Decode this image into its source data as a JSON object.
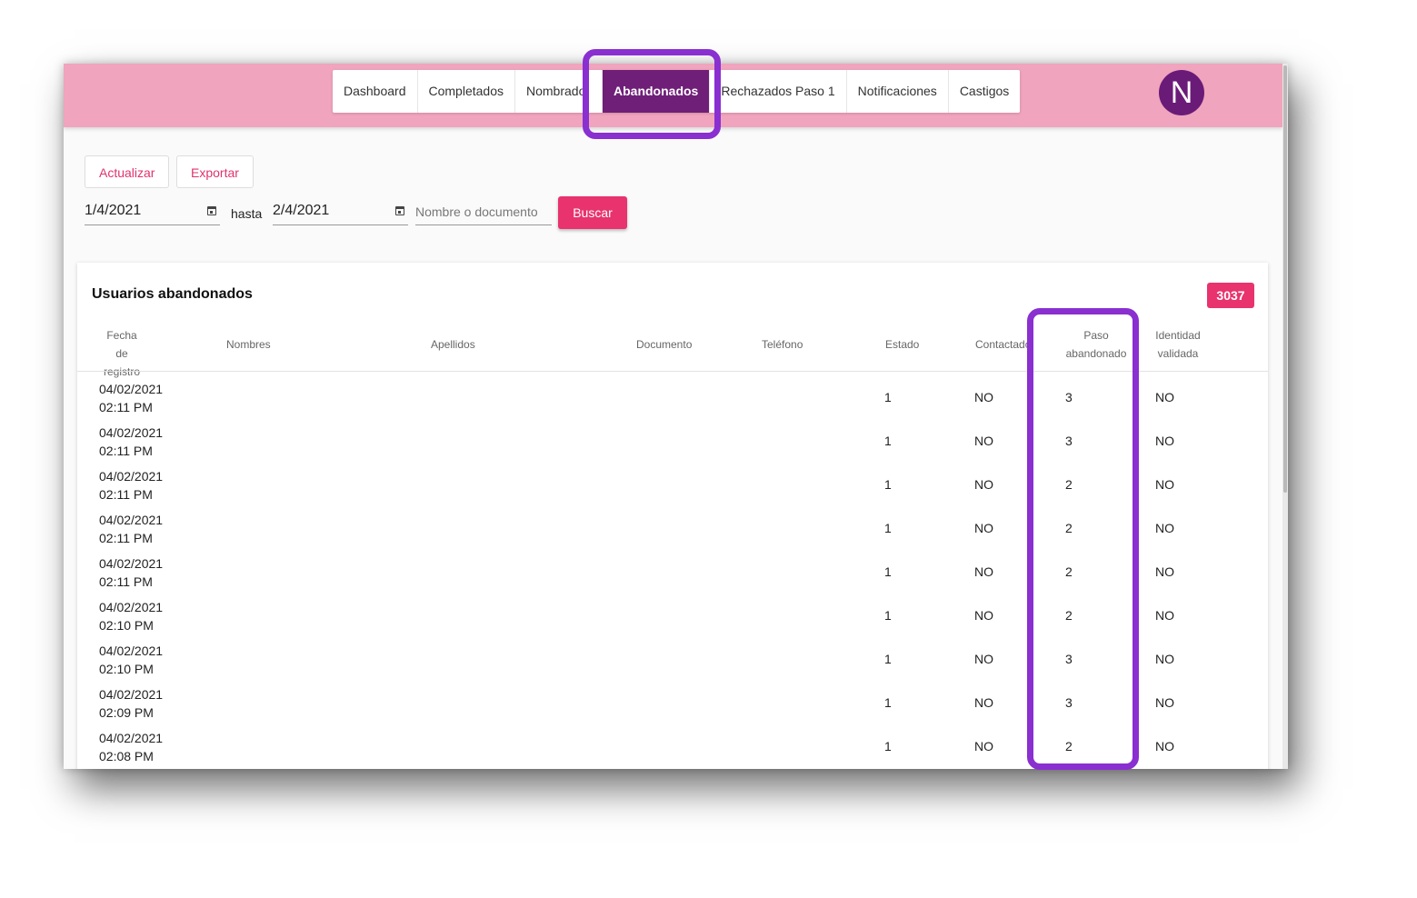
{
  "nav": {
    "tabs": [
      "Dashboard",
      "Completados",
      "Nombrado",
      "Abandonados",
      "Rechazados Paso 1",
      "Notificaciones",
      "Castigos"
    ],
    "active_tab": "Abandonados",
    "avatar_initial": "N"
  },
  "toolbar": {
    "refresh_label": "Actualizar",
    "export_label": "Exportar",
    "date_from": "1/4/2021",
    "date_separator": "hasta",
    "date_to": "2/4/2021",
    "search_placeholder": "Nombre o documento",
    "search_value": "",
    "search_button": "Buscar"
  },
  "table": {
    "title": "Usuarios abandonados",
    "total_count": "3037",
    "columns": [
      {
        "l1": "Fecha de",
        "l2": "registro"
      },
      {
        "l1": "Nombres",
        "l2": ""
      },
      {
        "l1": "Apellidos",
        "l2": ""
      },
      {
        "l1": "Documento",
        "l2": ""
      },
      {
        "l1": "Teléfono",
        "l2": ""
      },
      {
        "l1": "Estado",
        "l2": ""
      },
      {
        "l1": "Contactado",
        "l2": ""
      },
      {
        "l1": "Paso",
        "l2": "abandonado"
      },
      {
        "l1": "Identidad",
        "l2": "validada"
      }
    ],
    "rows": [
      {
        "date": "04/02/2021",
        "time": "02:11 PM",
        "estado": "1",
        "contactado": "NO",
        "paso": "3",
        "identidad": "NO"
      },
      {
        "date": "04/02/2021",
        "time": "02:11 PM",
        "estado": "1",
        "contactado": "NO",
        "paso": "3",
        "identidad": "NO"
      },
      {
        "date": "04/02/2021",
        "time": "02:11 PM",
        "estado": "1",
        "contactado": "NO",
        "paso": "2",
        "identidad": "NO"
      },
      {
        "date": "04/02/2021",
        "time": "02:11 PM",
        "estado": "1",
        "contactado": "NO",
        "paso": "2",
        "identidad": "NO"
      },
      {
        "date": "04/02/2021",
        "time": "02:11 PM",
        "estado": "1",
        "contactado": "NO",
        "paso": "2",
        "identidad": "NO"
      },
      {
        "date": "04/02/2021",
        "time": "02:10 PM",
        "estado": "1",
        "contactado": "NO",
        "paso": "2",
        "identidad": "NO"
      },
      {
        "date": "04/02/2021",
        "time": "02:10 PM",
        "estado": "1",
        "contactado": "NO",
        "paso": "3",
        "identidad": "NO"
      },
      {
        "date": "04/02/2021",
        "time": "02:09 PM",
        "estado": "1",
        "contactado": "NO",
        "paso": "3",
        "identidad": "NO"
      },
      {
        "date": "04/02/2021",
        "time": "02:08 PM",
        "estado": "1",
        "contactado": "NO",
        "paso": "2",
        "identidad": "NO"
      }
    ]
  },
  "colors": {
    "topbar": "#f0a4bd",
    "active_tab": "#6f1f78",
    "accent": "#e8336e",
    "highlight": "#8a2fd0"
  }
}
